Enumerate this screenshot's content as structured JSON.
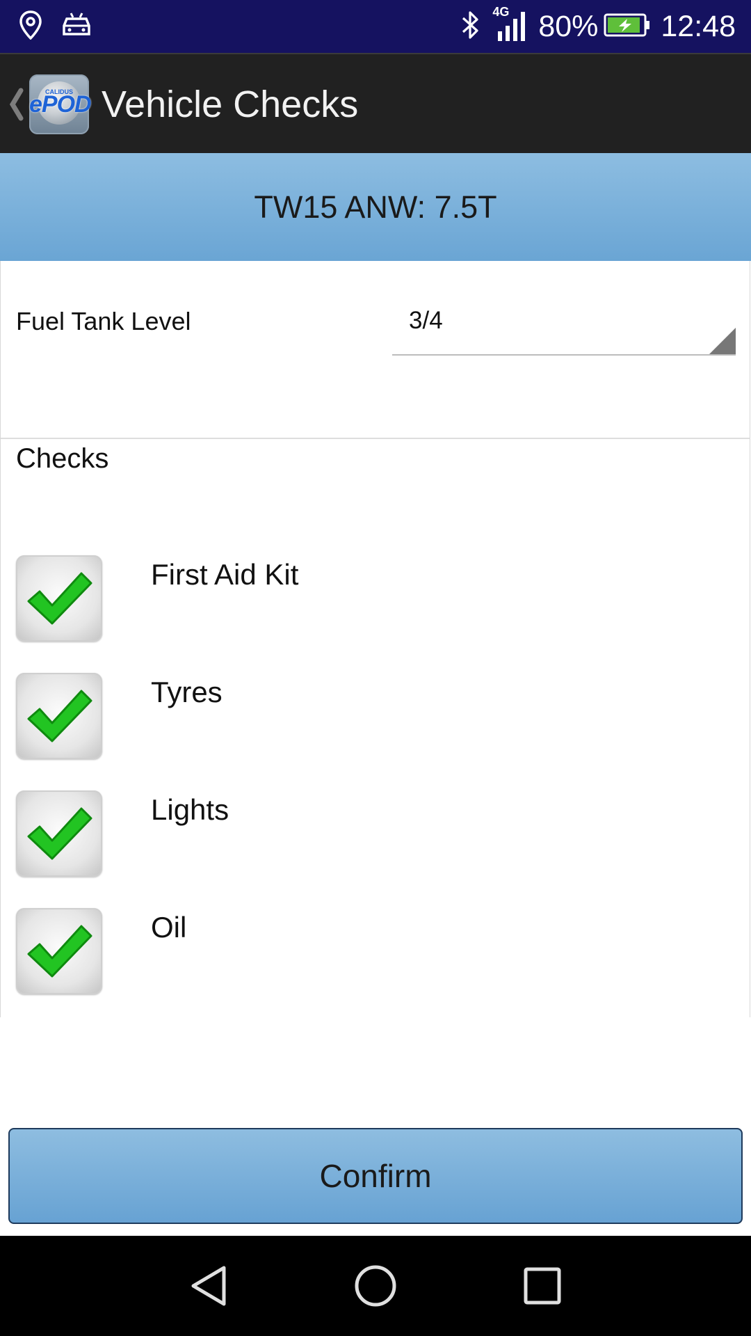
{
  "status_bar": {
    "network_label": "4G",
    "battery": "80%",
    "time": "12:48",
    "icons": [
      "location-icon",
      "car-mode-icon",
      "bluetooth-icon",
      "signal-icon",
      "battery-charging-icon"
    ]
  },
  "action_bar": {
    "logo_text": "ePOD",
    "logo_subtext": "CALIDUS",
    "title": "Vehicle Checks"
  },
  "vehicle": {
    "header": "TW15 ANW: 7.5T"
  },
  "fuel": {
    "label": "Fuel Tank Level",
    "value": "3/4"
  },
  "checks": {
    "title": "Checks",
    "items": [
      {
        "label": "First Aid Kit",
        "checked": true
      },
      {
        "label": "Tyres",
        "checked": true
      },
      {
        "label": "Lights",
        "checked": true
      },
      {
        "label": "Oil",
        "checked": true
      }
    ]
  },
  "confirm": {
    "label": "Confirm"
  },
  "colors": {
    "status_bar": "#151260",
    "action_bar": "#212121",
    "accent_blue": "#7ab1da",
    "check_green": "#22c422"
  }
}
